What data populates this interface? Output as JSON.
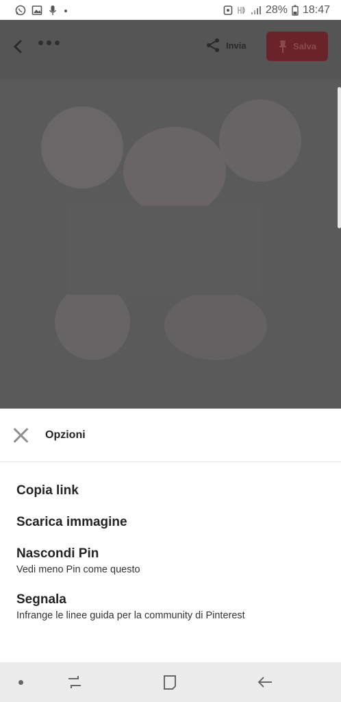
{
  "status_bar": {
    "battery_pct": "28%",
    "time": "18:47",
    "left_icons": [
      "whatsapp-icon",
      "gallery-icon",
      "microphone-icon",
      "notification-dot-icon"
    ],
    "right_icons": [
      "alarm-icon",
      "signal-hd-icon",
      "signal-bars-icon",
      "battery-icon"
    ]
  },
  "pin_header": {
    "share_label": "Invia",
    "save_label": "Salva"
  },
  "options_sheet": {
    "title": "Opzioni",
    "items": [
      {
        "label": "Copia link"
      },
      {
        "label": "Scarica immagine"
      },
      {
        "label": "Nascondi Pin",
        "subtitle": "Vedi meno Pin come questo"
      },
      {
        "label": "Segnala",
        "subtitle": "Infrange le linee guida per la community di Pinterest"
      }
    ]
  },
  "nav_bar": {
    "icons": [
      "menu-dot-icon",
      "recents-icon",
      "home-icon",
      "back-icon"
    ]
  },
  "colors": {
    "overlay": "#555555",
    "save_button": "#6a2328",
    "sheet_background": "#ffffff",
    "nav_background": "#ececec"
  }
}
